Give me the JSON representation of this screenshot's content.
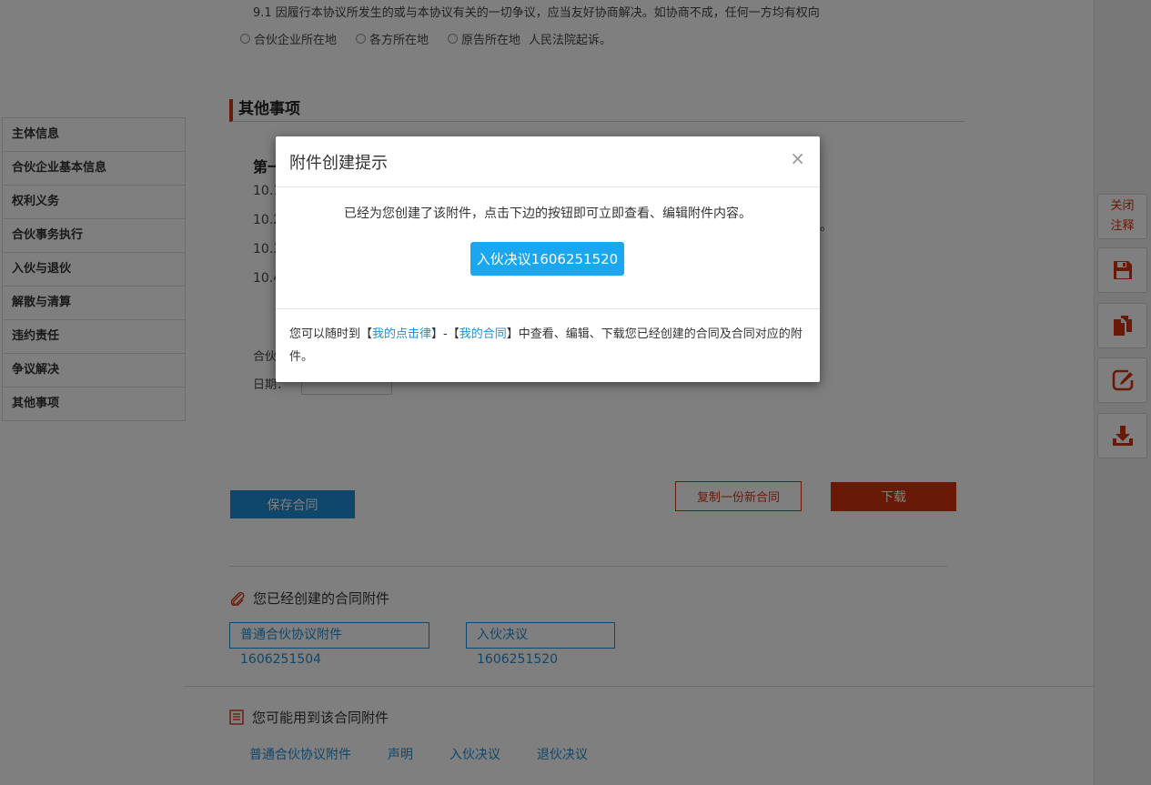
{
  "contract": {
    "clause_9_1": "9.1  因履行本协议所发生的或与本协议有关的一切争议，应当友好协商解决。如协商不成，任何一方均有权向",
    "court_options": [
      "合伙企业所在地",
      "各方所在地",
      "原告所在地"
    ],
    "court_tail": "人民法院起诉。",
    "section_title": "其他事项",
    "article_heading": "第一",
    "clause_nums": [
      "10.1",
      "10.2",
      "10.3",
      "10.4"
    ],
    "ellipsis": "。",
    "party_label": "合伙",
    "date_label": "日期："
  },
  "sidebar": {
    "items": [
      {
        "label": "主体信息"
      },
      {
        "label": "合伙企业基本信息"
      },
      {
        "label": "权利义务"
      },
      {
        "label": "合伙事务执行"
      },
      {
        "label": "入伙与退伙"
      },
      {
        "label": "解散与清算"
      },
      {
        "label": "违约责任"
      },
      {
        "label": "争议解决"
      },
      {
        "label": "其他事项"
      }
    ]
  },
  "actions": {
    "save_label": "保存合同",
    "copy_label": "复制一份新合同",
    "download_label": "下载"
  },
  "created_attachments": {
    "title": "您已经创建的合同附件",
    "items": [
      "普通合伙协议附件1606251504",
      "入伙决议1606251520"
    ]
  },
  "related_attachments": {
    "title": "您可能用到该合同附件",
    "links": [
      "普通合伙协议附件",
      "声明",
      "入伙决议",
      "退伙决议"
    ]
  },
  "toolbar": {
    "close_notes_line1": "关闭",
    "close_notes_line2": "注释"
  },
  "modal": {
    "title": "附件创建提示",
    "close_symbol": "×",
    "message": "已经为您创建了该附件，点击下边的按钮即可立即查看、编辑附件内容。",
    "primary_button": "入伙决议1606251520",
    "footer_pre": "您可以随时到【",
    "footer_link1": "我的点击律",
    "footer_mid": "】-【",
    "footer_link2": "我的合同",
    "footer_post": "】中查看、编辑、下载您已经创建的合同及合同对应的附件。"
  },
  "colors": {
    "accent_red": "#d2350f",
    "accent_blue": "#1f8fd7",
    "modal_button_blue": "#1aa7f0",
    "overlay": "rgba(0,0,0,0.5)"
  }
}
